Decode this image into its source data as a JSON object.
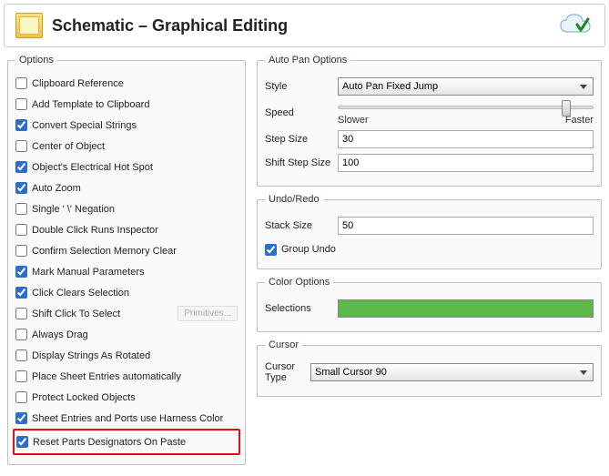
{
  "header": {
    "title": "Schematic – Graphical Editing"
  },
  "options": {
    "legend": "Options",
    "items": [
      {
        "label": "Clipboard Reference",
        "checked": false
      },
      {
        "label": "Add Template to Clipboard",
        "checked": false
      },
      {
        "label": "Convert Special Strings",
        "checked": true
      },
      {
        "label": "Center of Object",
        "checked": false
      },
      {
        "label": "Object's Electrical Hot Spot",
        "checked": true
      },
      {
        "label": "Auto Zoom",
        "checked": true
      },
      {
        "label": "Single ' \\' Negation",
        "checked": false
      },
      {
        "label": "Double Click Runs Inspector",
        "checked": false
      },
      {
        "label": "Confirm Selection Memory Clear",
        "checked": false
      },
      {
        "label": "Mark Manual Parameters",
        "checked": true
      },
      {
        "label": "Click Clears Selection",
        "checked": true
      },
      {
        "label": "Shift Click To Select",
        "checked": false,
        "has_button": true
      },
      {
        "label": "Always Drag",
        "checked": false
      },
      {
        "label": "Display Strings As Rotated",
        "checked": false
      },
      {
        "label": "Place Sheet Entries automatically",
        "checked": false
      },
      {
        "label": "Protect Locked Objects",
        "checked": false
      },
      {
        "label": "Sheet Entries and Ports use Harness Color",
        "checked": true
      },
      {
        "label": "Reset Parts Designators On Paste",
        "checked": true,
        "highlight": true
      }
    ],
    "primitives_button": "Primitives..."
  },
  "autopan": {
    "legend": "Auto Pan Options",
    "style_label": "Style",
    "style_value": "Auto Pan Fixed Jump",
    "speed_label": "Speed",
    "slower": "Slower",
    "faster": "Faster",
    "step_size_label": "Step Size",
    "step_size_value": "30",
    "shift_step_label": "Shift Step Size",
    "shift_step_value": "100"
  },
  "undo": {
    "legend": "Undo/Redo",
    "stack_label": "Stack Size",
    "stack_value": "50",
    "group_undo_label": "Group Undo",
    "group_undo_checked": true
  },
  "color": {
    "legend": "Color Options",
    "selections_label": "Selections",
    "selections_color": "#5fb94a"
  },
  "cursor": {
    "legend": "Cursor",
    "type_label": "Cursor Type",
    "type_value": "Small Cursor 90"
  }
}
